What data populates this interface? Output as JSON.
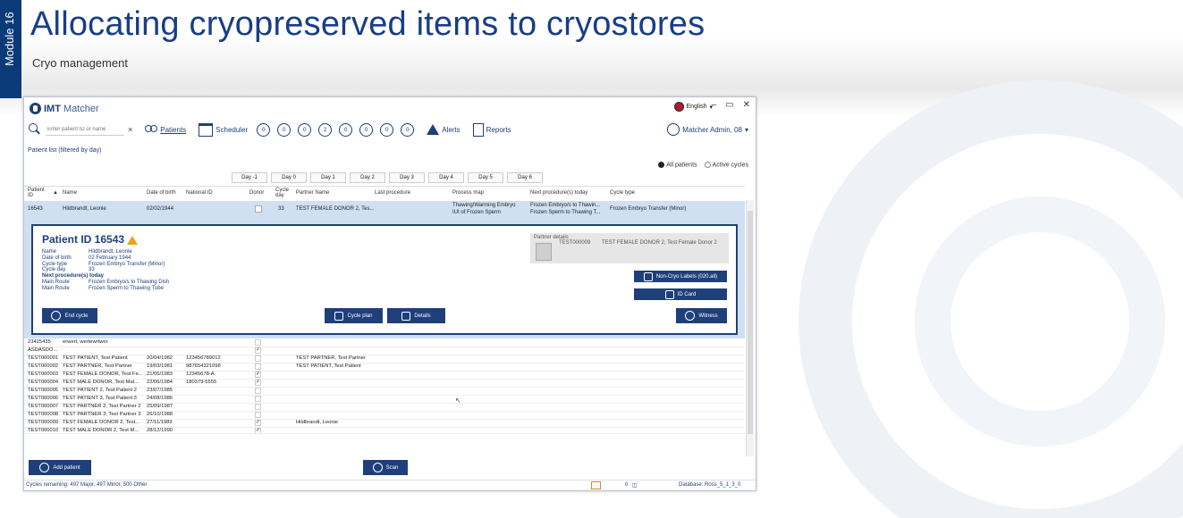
{
  "slide": {
    "module_tab": "Module 16",
    "title": "Allocating cryopreserved items to cryostores",
    "subtitle": "Cryo management"
  },
  "app": {
    "logo_bold": "IMT",
    "logo_rest": "Matcher",
    "language": "English",
    "search_placeholder": "Enter patient ID or name",
    "toolbar": {
      "patients": "Patients",
      "scheduler": "Scheduler",
      "counts": [
        "0",
        "0",
        "0",
        "2",
        "0",
        "0",
        "0",
        "0"
      ],
      "alerts": "Alerts",
      "reports": "Reports"
    },
    "user": "Matcher Admin, 08",
    "list_label": "Patient list (filtered by day)",
    "filter_all": "All patients",
    "filter_active": "Active cycles",
    "day_buttons": [
      "Day -1",
      "Day 0",
      "Day 1",
      "Day 2",
      "Day 3",
      "Day 4",
      "Day 5",
      "Day 6"
    ],
    "columns": {
      "patient_id": "Patient ID",
      "name": "Name",
      "dob": "Date of birth",
      "national_id": "National ID",
      "donor": "Donor",
      "cycle_day": "Cycle day",
      "partner_name": "Partner Name",
      "last_procedure": "Last procedure",
      "process_map": "Process map",
      "next_procedure": "Next procedure(s) today",
      "cycle_type": "Cycle type"
    },
    "selected": {
      "id": "16543",
      "name": "Hildbrandt, Leonie",
      "dob": "02/02/1944",
      "cycle_day": "33",
      "partner": "TEST FEMALE DONOR 2, Tes...",
      "process_map_1": "Thawing/Warming Embryo",
      "process_map_2": "IUI of Frozen Sperm",
      "next_1": "Frozen Embryo/s to Thawin...",
      "next_2": "Frozen Sperm to Thawing T...",
      "cycle_type": "Frozen Embryo Transfer (Minor)"
    },
    "detail": {
      "title": "Patient ID 16543",
      "name_k": "Name",
      "name_v": "Hildbrandt, Leonie",
      "dob_k": "Date of birth",
      "dob_v": "02 February 1944",
      "ct_k": "Cycle type",
      "ct_v": "Frozen Embryo Transfer (Minor)",
      "cd_k": "Cycle day",
      "cd_v": "33",
      "next_heading": "Next procedure(s) today",
      "route1_k": "Main Route",
      "route1_v": "Frozen Embryo/s to Thawing Dish",
      "route2_k": "Main Route",
      "route2_v": "Frozen Sperm to Thawing Tube",
      "partner_label": "Partner details",
      "partner_id": "TEST000009",
      "partner_name": "TEST FEMALE DONOR 2, Test Female Donor 2",
      "btn_labels": "Non-Cryo Labels (020.all)",
      "btn_idcard": "ID Card",
      "btn_end": "End cycle",
      "btn_cycleplan": "Cycle plan",
      "btn_details": "Details",
      "btn_witness": "Witness"
    },
    "rows": [
      {
        "id": "23425435",
        "name": "erwert, wertewrtwer",
        "dob": "",
        "nid": "",
        "donor": "",
        "partner": ""
      },
      {
        "id": "ASDASDO...",
        "name": "",
        "dob": "",
        "nid": "",
        "donor": "✓",
        "partner": ""
      },
      {
        "id": "TEST000001",
        "name": "TEST PATIENT, Test Patient",
        "dob": "20/04/1982",
        "nid": "123456789012",
        "donor": "",
        "partner": "TEST PARTNER, Test Partner"
      },
      {
        "id": "TEST000002",
        "name": "TEST PARTNER, Test Partner",
        "dob": "19/03/1981",
        "nid": "987654321098",
        "donor": "",
        "partner": "TEST PATIENT, Test Patient"
      },
      {
        "id": "TEST000003",
        "name": "TEST FEMALE DONOR, Test Fe...",
        "dob": "21/05/1983",
        "nid": "12345678-A",
        "donor": "✓",
        "partner": ""
      },
      {
        "id": "TEST000004",
        "name": "TEST MALE DONOR, Test Mal...",
        "dob": "22/06/1984",
        "nid": "180379-5555",
        "donor": "✓",
        "partner": ""
      },
      {
        "id": "TEST000005",
        "name": "TEST PATIENT 2, Test Patient 2",
        "dob": "23/07/1985",
        "nid": "",
        "donor": "",
        "partner": ""
      },
      {
        "id": "TEST000006",
        "name": "TEST PATIENT 3, Test Patient 3",
        "dob": "24/08/1986",
        "nid": "",
        "donor": "",
        "partner": ""
      },
      {
        "id": "TEST000007",
        "name": "TEST PARTNER 2, Test Partner 2",
        "dob": "25/09/1987",
        "nid": "",
        "donor": "",
        "partner": ""
      },
      {
        "id": "TEST000008",
        "name": "TEST PARTNER 3, Test Partner 3",
        "dob": "26/10/1988",
        "nid": "",
        "donor": "",
        "partner": ""
      },
      {
        "id": "TEST000009",
        "name": "TEST FEMALE DONOR 2, Test...",
        "dob": "27/11/1989",
        "nid": "",
        "donor": "✓",
        "partner": "Hildbrandt, Leonie"
      },
      {
        "id": "TEST000010",
        "name": "TEST MALE DONOR 2, Test M...",
        "dob": "28/12/1990",
        "nid": "",
        "donor": "✓",
        "partner": ""
      }
    ],
    "add_patient": "Add patient",
    "scan": "Scan",
    "status_left": "Cycles remaining: 497 Major, 497 Minor, 500 Other",
    "status_count": "0",
    "status_db": "Database: Ross_5_1_3_0"
  }
}
